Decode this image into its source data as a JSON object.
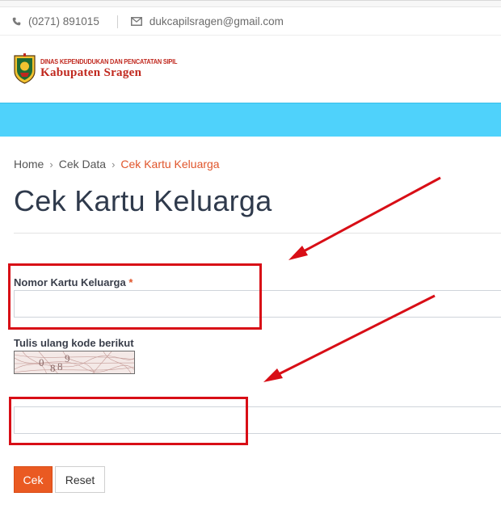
{
  "contact": {
    "phone": "(0271) 891015",
    "email": "dukcapilsragen@gmail.com",
    "phone_icon": "phone-icon",
    "email_icon": "envelope-icon"
  },
  "logo": {
    "line1": "DINAS KEPENDUDUKAN DAN PENCATATAN SIPIL",
    "line2": "Kabupaten Sragen",
    "emblem_icon": "coat-of-arms"
  },
  "breadcrumb": {
    "home": "Home",
    "level2": "Cek Data",
    "current": "Cek Kartu Keluarga",
    "separator": "›"
  },
  "page": {
    "title": "Cek Kartu Keluarga"
  },
  "form": {
    "kk_label": "Nomor Kartu Keluarga",
    "required_mark": "*",
    "kk_value": "",
    "captcha_label": "Tulis ulang kode berikut",
    "captcha_code": "0889",
    "captcha_value": "",
    "submit_label": "Cek",
    "reset_label": "Reset"
  },
  "colors": {
    "accent": "#ea5a22",
    "navbar": "#4fd2fb",
    "annotation": "#d80e16",
    "logo_text": "#c0281e"
  }
}
